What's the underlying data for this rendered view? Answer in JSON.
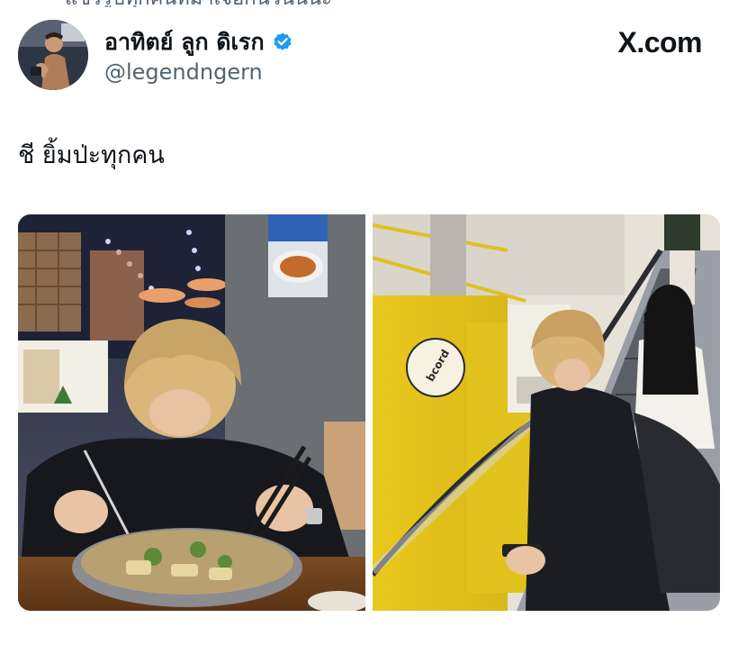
{
  "header_partial_text": "แชร์รูปทุกคนที่มาเจอกันวันนี้นะ",
  "author": {
    "display_name": "อาทิตย์ ลูก ดิเรก",
    "handle": "@legendngern",
    "verified": true,
    "verified_color": "#1d9bf0"
  },
  "brand": {
    "label": "X.com"
  },
  "tweet": {
    "text": "ชี ยิ้มป่ะทุกคน"
  },
  "media": {
    "photo_1_sign_text": "",
    "photo_2_logo_text": "bcord"
  },
  "colors": {
    "text_primary": "#0f1419",
    "text_secondary": "#536471",
    "accent_yellow": "#e9c81e"
  }
}
